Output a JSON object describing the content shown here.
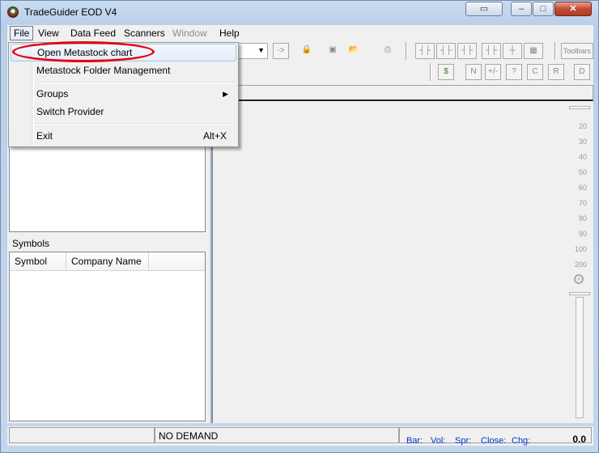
{
  "window": {
    "title": "TradeGuider EOD V4",
    "controls": {
      "restore": "▭",
      "minimize": "–",
      "maximize": "□",
      "close": "✕"
    }
  },
  "menubar": {
    "items": [
      {
        "label": "File",
        "active": true
      },
      {
        "label": "View"
      },
      {
        "label": "Data Feed"
      },
      {
        "label": "Scanners"
      },
      {
        "label": "Window",
        "disabled": true
      },
      {
        "label": "Help"
      }
    ]
  },
  "file_menu": {
    "items": [
      {
        "label": "Open Metastock chart",
        "highlighted": true,
        "annotated": true
      },
      {
        "label": "Metastock Folder Management"
      },
      {
        "label": "Groups",
        "submenu": true,
        "arrow": "▶"
      },
      {
        "label": "Switch Provider"
      },
      {
        "label": "Exit",
        "shortcut": "Alt+X"
      }
    ]
  },
  "toolbar": {
    "toolbars_label": "Toolbars",
    "arrow": "->",
    "indicator_letters": [
      "N",
      "+/-",
      "?",
      "C",
      "R",
      "D"
    ]
  },
  "left_panel": {
    "symbols_label": "Symbols",
    "columns": [
      "Symbol",
      "Company Name"
    ]
  },
  "scale": {
    "labels": [
      "20",
      "30",
      "40",
      "50",
      "60",
      "70",
      "80",
      "90",
      "100",
      "200"
    ]
  },
  "statusbar": {
    "status_text": "NO DEMAND",
    "bar": "Bar:",
    "vol": "Vol:",
    "spr": "Spr:",
    "close": "Close:",
    "chg": "Chg:",
    "value": "0.0"
  },
  "colors": {
    "annotation": "#e8000b",
    "status_blue": "#0033cc"
  }
}
